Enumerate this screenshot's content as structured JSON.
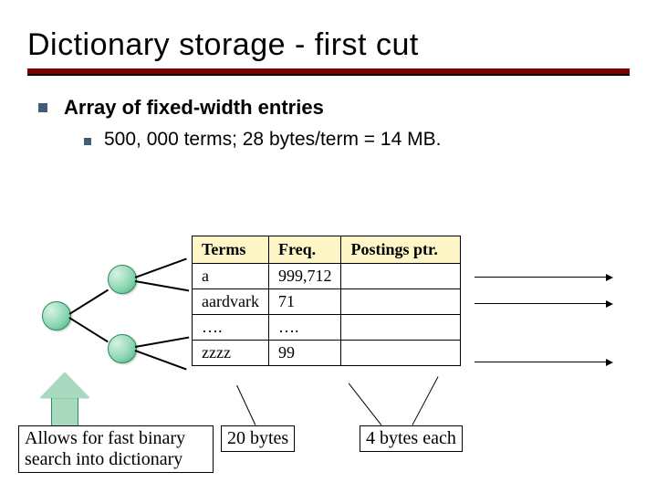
{
  "title": "Dictionary storage - first cut",
  "bullets": {
    "b1": "Array of fixed-width entries",
    "b2": "500, 000 terms; 28 bytes/term = 14 MB."
  },
  "table": {
    "headers": {
      "terms": "Terms",
      "freq": "Freq.",
      "ptr": "Postings ptr."
    },
    "rows": [
      {
        "term": "a",
        "freq": "999,712"
      },
      {
        "term": "aardvark",
        "freq": "71"
      },
      {
        "term": "….",
        "freq": "…."
      },
      {
        "term": "zzzz",
        "freq": "99"
      }
    ]
  },
  "captions": {
    "binary": "Allows for fast binary\nsearch into dictionary",
    "bytes20": "20 bytes",
    "bytes4": "4 bytes each"
  }
}
